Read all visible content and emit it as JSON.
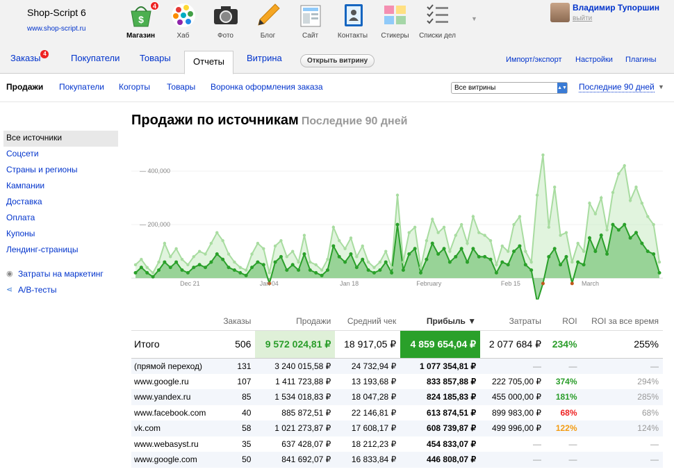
{
  "brand": {
    "name": "Shop-Script 6",
    "url": "www.shop-script.ru"
  },
  "apps": [
    {
      "label": "Магазин",
      "icon": "basket-icon",
      "badge": "4",
      "active": true
    },
    {
      "label": "Хаб",
      "icon": "hub-icon"
    },
    {
      "label": "Фото",
      "icon": "camera-icon"
    },
    {
      "label": "Блог",
      "icon": "pencil-icon"
    },
    {
      "label": "Сайт",
      "icon": "site-icon"
    },
    {
      "label": "Контакты",
      "icon": "contacts-icon"
    },
    {
      "label": "Стикеры",
      "icon": "stickers-icon"
    },
    {
      "label": "Списки дел",
      "icon": "checklist-icon"
    }
  ],
  "user": {
    "name": "Владимир Тупоршин",
    "logout": "выйти"
  },
  "tabs": {
    "orders": "Заказы",
    "orders_badge": "4",
    "customers": "Покупатели",
    "products": "Товары",
    "reports": "Отчеты",
    "storefront": "Витрина",
    "open_storefront": "Открыть витрину",
    "import_export": "Импорт/экспорт",
    "settings": "Настройки",
    "plugins": "Плагины"
  },
  "subnav": {
    "items": [
      "Продажи",
      "Покупатели",
      "Когорты",
      "Товары",
      "Воронка оформления заказа"
    ],
    "store_select": "Все витрины",
    "period": "Последние 90 дней"
  },
  "sidebar": {
    "items": [
      "Все источники",
      "Соцсети",
      "Страны и регионы",
      "Кампании",
      "Доставка",
      "Оплата",
      "Купоны",
      "Лендинг-страницы"
    ],
    "marketing": "Затраты на маркетинг",
    "ab": "A/B-тесты"
  },
  "title": {
    "main": "Продажи по источникам",
    "sub": "Последние 90 дней"
  },
  "chart_data": {
    "type": "area",
    "x_labels": [
      "Dec 21",
      "Jan 04",
      "Jan 18",
      "February",
      "Feb 15",
      "March"
    ],
    "y_ticks": [
      "400,000",
      "200,000"
    ],
    "ylim": [
      -80000,
      530000
    ],
    "colors": {
      "sales": "#a8dca0",
      "profit": "#2aa02a",
      "loss": "#c0581c"
    },
    "series": [
      {
        "name": "sales",
        "values": [
          50000,
          70000,
          40000,
          20000,
          60000,
          130000,
          80000,
          110000,
          70000,
          50000,
          80000,
          100000,
          90000,
          130000,
          170000,
          140000,
          90000,
          60000,
          40000,
          30000,
          90000,
          130000,
          110000,
          20000,
          120000,
          140000,
          80000,
          100000,
          60000,
          160000,
          60000,
          50000,
          30000,
          70000,
          190000,
          140000,
          110000,
          150000,
          80000,
          120000,
          60000,
          40000,
          60000,
          100000,
          40000,
          310000,
          60000,
          170000,
          190000,
          40000,
          140000,
          220000,
          170000,
          190000,
          100000,
          160000,
          200000,
          130000,
          230000,
          170000,
          160000,
          140000,
          50000,
          120000,
          100000,
          200000,
          230000,
          100000,
          60000,
          310000,
          460000,
          190000,
          340000,
          160000,
          170000,
          60000,
          130000,
          100000,
          280000,
          240000,
          300000,
          180000,
          320000,
          390000,
          420000,
          290000,
          340000,
          280000,
          230000,
          200000,
          60000
        ]
      },
      {
        "name": "profit",
        "values": [
          20000,
          40000,
          20000,
          5000,
          30000,
          60000,
          40000,
          60000,
          30000,
          20000,
          40000,
          50000,
          40000,
          60000,
          90000,
          70000,
          40000,
          30000,
          20000,
          10000,
          40000,
          60000,
          50000,
          -20000,
          60000,
          80000,
          30000,
          50000,
          30000,
          90000,
          30000,
          20000,
          10000,
          30000,
          120000,
          80000,
          60000,
          90000,
          40000,
          70000,
          30000,
          20000,
          30000,
          60000,
          20000,
          200000,
          30000,
          90000,
          110000,
          20000,
          70000,
          130000,
          90000,
          110000,
          60000,
          80000,
          110000,
          60000,
          110000,
          80000,
          80000,
          70000,
          20000,
          60000,
          50000,
          100000,
          120000,
          50000,
          30000,
          -90000,
          -20000,
          80000,
          110000,
          50000,
          80000,
          -20000,
          60000,
          50000,
          150000,
          100000,
          160000,
          90000,
          200000,
          180000,
          200000,
          150000,
          170000,
          130000,
          100000,
          90000,
          20000
        ]
      }
    ]
  },
  "table": {
    "headers": [
      "",
      "Заказы",
      "Продажи",
      "Средний чек",
      "Прибыль ▼",
      "Затраты",
      "ROI",
      "ROI за все время"
    ],
    "total": {
      "label": "Итого",
      "orders": "506",
      "sales": "9 572 024,81 ₽",
      "avg": "18 917,05 ₽",
      "profit": "4 859 654,04 ₽",
      "costs": "2 077 684 ₽",
      "roi": "234%",
      "roi_all": "255%"
    },
    "rows": [
      {
        "source": "(прямой переход)",
        "orders": "131",
        "sales": "3 240 015,58 ₽",
        "avg": "24 732,94 ₽",
        "profit": "1 077 354,81 ₽",
        "costs": "—",
        "roi": "—",
        "roi_all": "—",
        "roi_color": "dim"
      },
      {
        "source": "www.google.ru",
        "orders": "107",
        "sales": "1 411 723,88 ₽",
        "avg": "13 193,68 ₽",
        "profit": "833 857,88 ₽",
        "costs": "222 705,00 ₽",
        "roi": "374%",
        "roi_all": "294%",
        "roi_color": "roig"
      },
      {
        "source": "www.yandex.ru",
        "orders": "85",
        "sales": "1 534 018,83 ₽",
        "avg": "18 047,28 ₽",
        "profit": "824 185,83 ₽",
        "costs": "455 000,00 ₽",
        "roi": "181%",
        "roi_all": "285%",
        "roi_color": "roig"
      },
      {
        "source": "www.facebook.com",
        "orders": "40",
        "sales": "885 872,51 ₽",
        "avg": "22 146,81 ₽",
        "profit": "613 874,51 ₽",
        "costs": "899 983,00 ₽",
        "roi": "68%",
        "roi_all": "68%",
        "roi_color": "roir"
      },
      {
        "source": "vk.com",
        "orders": "58",
        "sales": "1 021 273,87 ₽",
        "avg": "17 608,17 ₽",
        "profit": "608 739,87 ₽",
        "costs": "499 996,00 ₽",
        "roi": "122%",
        "roi_all": "124%",
        "roi_color": "roio"
      },
      {
        "source": "www.webasyst.ru",
        "orders": "35",
        "sales": "637 428,07 ₽",
        "avg": "18 212,23 ₽",
        "profit": "454 833,07 ₽",
        "costs": "—",
        "roi": "—",
        "roi_all": "—",
        "roi_color": "dim"
      },
      {
        "source": "www.google.com",
        "orders": "50",
        "sales": "841 692,07 ₽",
        "avg": "16 833,84 ₽",
        "profit": "446 808,07 ₽",
        "costs": "—",
        "roi": "—",
        "roi_all": "—",
        "roi_color": "dim"
      }
    ]
  }
}
